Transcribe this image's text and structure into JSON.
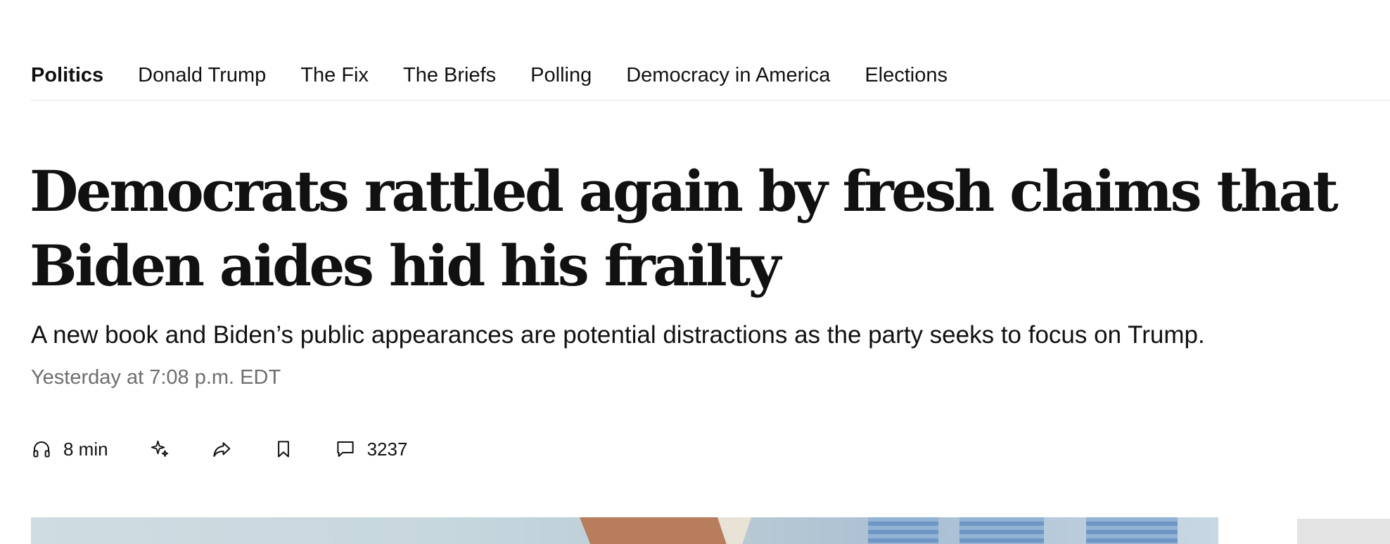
{
  "nav": {
    "items": [
      {
        "label": "Politics",
        "active": true
      },
      {
        "label": "Donald Trump",
        "active": false
      },
      {
        "label": "The Fix",
        "active": false
      },
      {
        "label": "The Briefs",
        "active": false
      },
      {
        "label": "Polling",
        "active": false
      },
      {
        "label": "Democracy in America",
        "active": false
      },
      {
        "label": "Elections",
        "active": false
      }
    ]
  },
  "article": {
    "headline": "Democrats rattled again by fresh claims that Biden aides hid his frailty",
    "dek": "A new book and Biden’s public appearances are potential distractions as the party seeks to focus on Trump.",
    "timestamp": "Yesterday at 7:08 p.m. EDT"
  },
  "actions": {
    "listen": {
      "icon": "headphones-icon",
      "label": "8 min"
    },
    "ai_summary": {
      "icon": "sparkle-icon"
    },
    "share": {
      "icon": "share-arrow-icon"
    },
    "save": {
      "icon": "bookmark-icon"
    },
    "comments": {
      "icon": "comment-icon",
      "label": "3237"
    }
  }
}
